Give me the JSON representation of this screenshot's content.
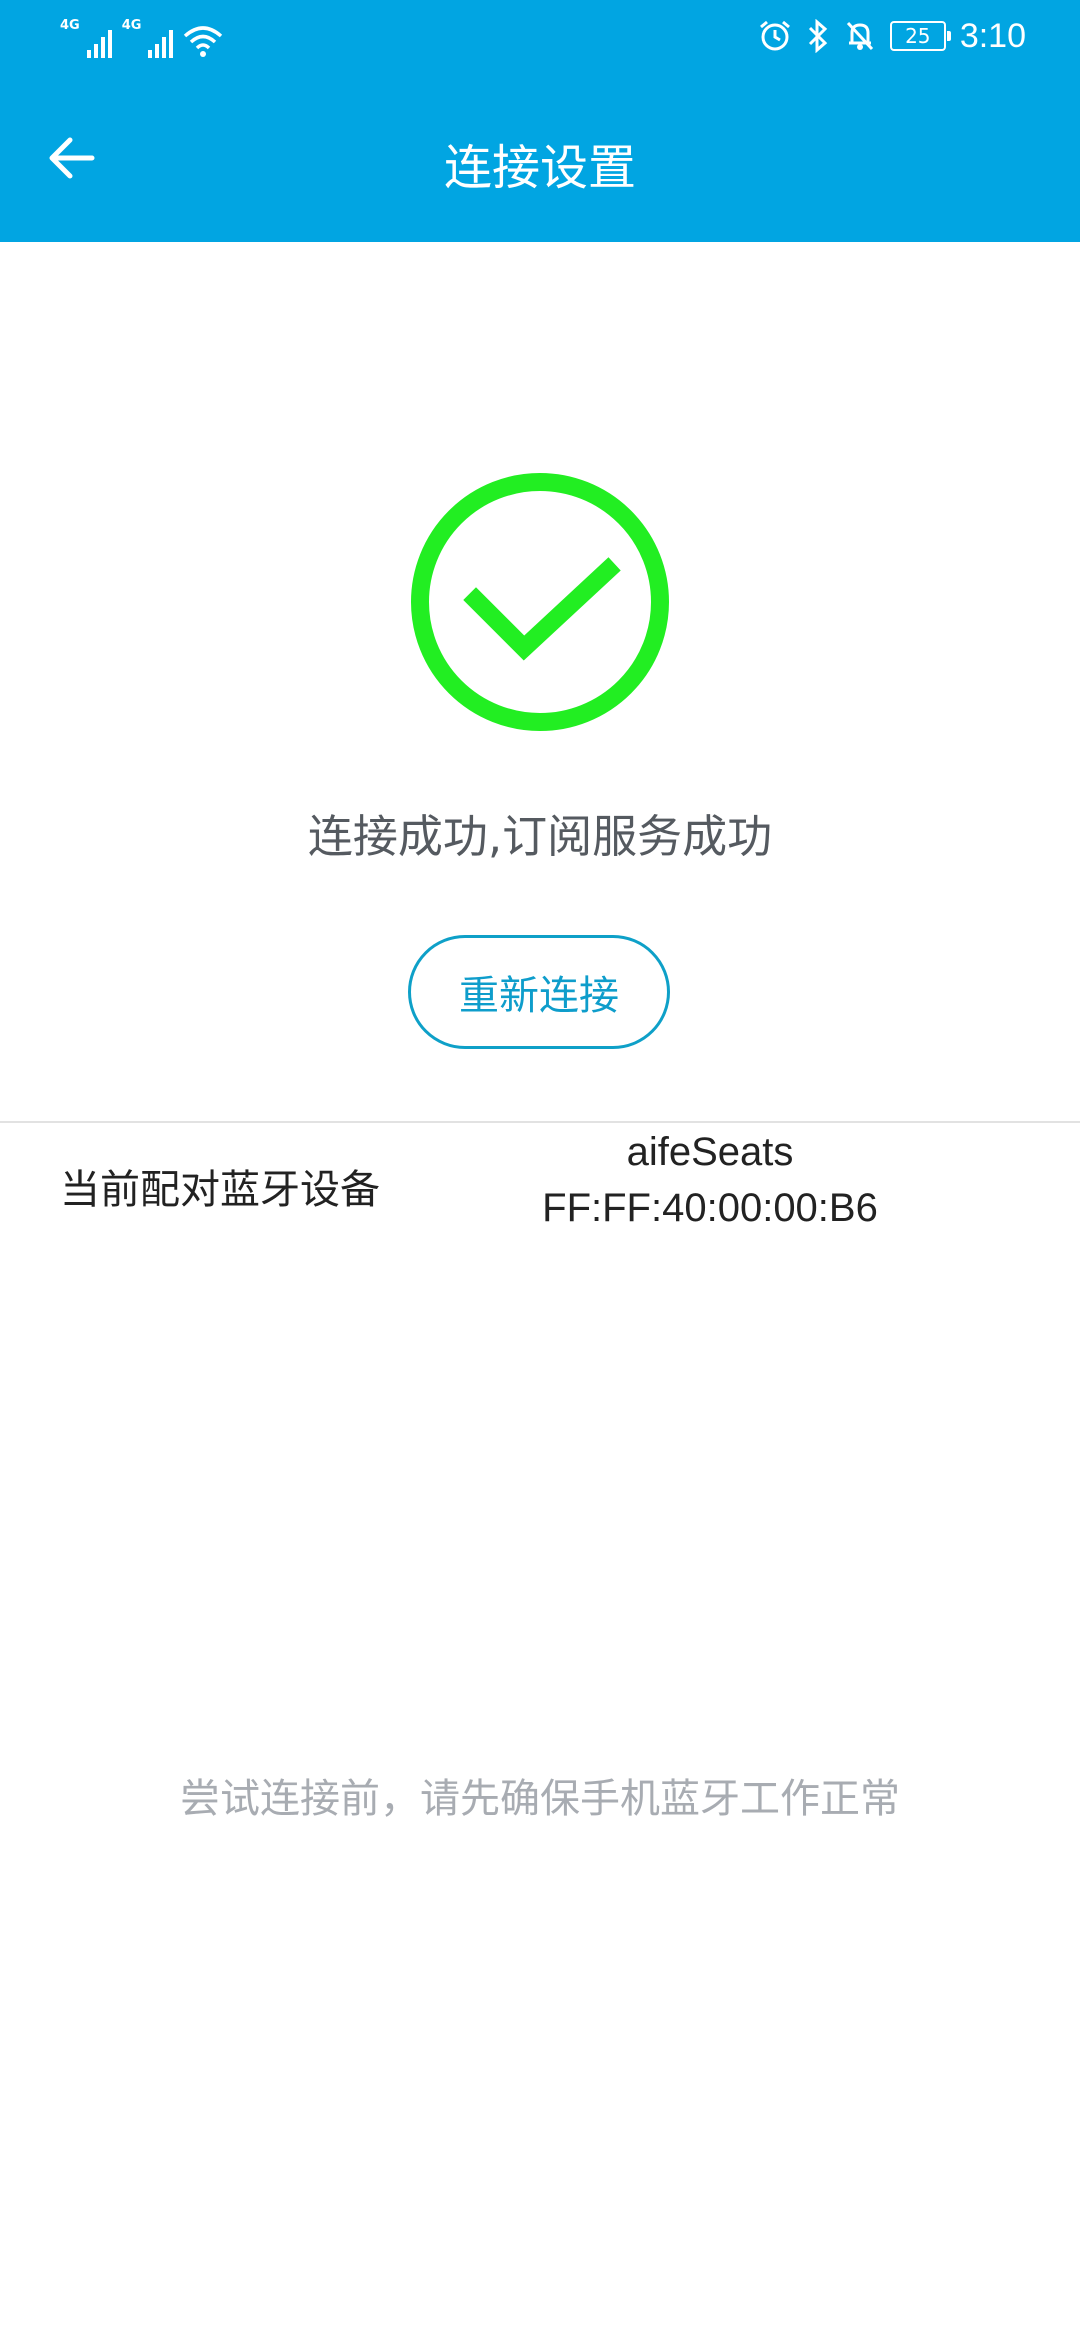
{
  "status_bar": {
    "network_1": "4G",
    "network_2": "4G",
    "battery": "25",
    "time": "3:10"
  },
  "header": {
    "title": "连接设置"
  },
  "connection": {
    "status_message": "连接成功,订阅服务成功",
    "reconnect_label": "重新连接"
  },
  "device": {
    "label": "当前配对蓝牙设备",
    "name": "aifeSeats",
    "mac": "FF:FF:40:00:00:B6"
  },
  "hint": "尝试连接前，请先确保手机蓝牙工作正常",
  "colors": {
    "header_bg": "#01A5E2",
    "success_green": "#22EE22",
    "accent_blue": "#0E9DCB"
  }
}
